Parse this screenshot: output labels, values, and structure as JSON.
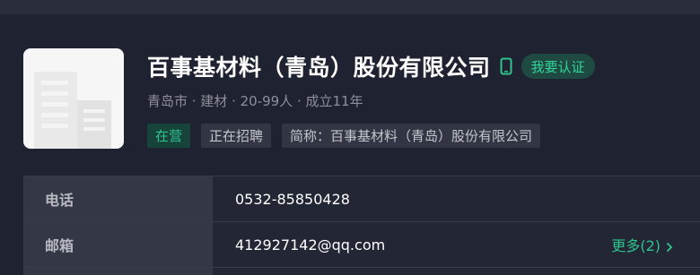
{
  "company": {
    "name": "百事基材料（青岛）股份有限公司",
    "verify_label": "我要认证",
    "meta": "青岛市 · 建材 · 20-99人 · 成立11年",
    "tags": {
      "status": "在营",
      "hiring": "正在招聘",
      "short_name": "简称：百事基材料（青岛）股份有限公司"
    }
  },
  "info": {
    "phone": {
      "label": "电话",
      "value": "0532-85850428"
    },
    "email": {
      "label": "邮箱",
      "value": "412927142@qq.com",
      "more": "更多(2)"
    }
  },
  "icons": {
    "phone": "phone-icon",
    "chevron": "chevron-right-icon",
    "logo": "building-logo"
  },
  "colors": {
    "background": "#1f2230",
    "accent_green": "#2fc38e",
    "verify_bg": "#1e4a42",
    "label_bg": "#343846"
  }
}
